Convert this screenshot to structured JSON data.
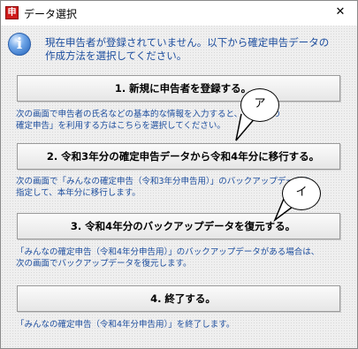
{
  "window": {
    "title": "データ選択",
    "close": "✕"
  },
  "app_icon": {
    "glyph": "申",
    "color": "#cf1b1b"
  },
  "intro": {
    "icon": "info-icon",
    "line1": "現在申告者が登録されていません。以下から確定申告データの",
    "line2": "作成方法を選択してください。"
  },
  "options": [
    {
      "label": "1. 新規に申告者を登録する。",
      "desc1": "次の画面で申告者の氏名などの基本的な情報を入力すると、「みんなの",
      "desc2": "確定申告」を利用する方はこちらを選択してください。"
    },
    {
      "label": "2. 令和3年分の確定申告データから令和4年分に移行する。",
      "desc1": "次の画面で「みんなの確定申告（令和3年分申告用）」のバックアップデータを",
      "desc2": "指定して、本年分に移行します。"
    },
    {
      "label": "3. 令和4年分のバックアップデータを復元する。",
      "desc1": "「みんなの確定申告（令和4年分申告用）」のバックアップデータがある場合は、",
      "desc2": "次の画面でバックアップデータを復元します。"
    },
    {
      "label": "4. 終了する。",
      "desc1": "「みんなの確定申告（令和4年分申告用）」を終了します。",
      "desc2": ""
    }
  ],
  "callouts": {
    "a": "ア",
    "i": "イ"
  },
  "colors": {
    "text_blue": "#1c4d9e",
    "background": "#efefef"
  }
}
